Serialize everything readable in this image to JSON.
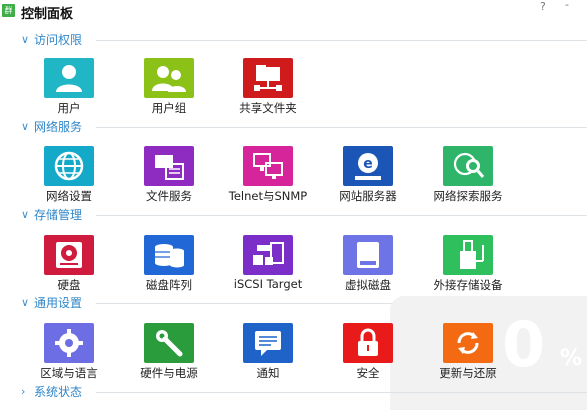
{
  "window": {
    "title": "控制面板",
    "help": "?",
    "dash": "-"
  },
  "sections": [
    {
      "label": "访问权限",
      "items": [
        {
          "label": "用户",
          "icon": "user-icon",
          "color": "#20b6c5"
        },
        {
          "label": "用户组",
          "icon": "user-group-icon",
          "color": "#8cc217"
        },
        {
          "label": "共享文件夹",
          "icon": "shared-folder-icon",
          "color": "#cf1b1b"
        }
      ]
    },
    {
      "label": "网络服务",
      "items": [
        {
          "label": "网络设置",
          "icon": "globe-icon",
          "color": "#14a9c8"
        },
        {
          "label": "文件服务",
          "icon": "file-service-icon",
          "color": "#8e2cc2"
        },
        {
          "label": "Telnet与SNMP",
          "icon": "monitors-icon",
          "color": "#d6249a"
        },
        {
          "label": "网站服务器",
          "icon": "web-server-icon",
          "color": "#1b55b6"
        },
        {
          "label": "网络探索服务",
          "icon": "network-discovery-icon",
          "color": "#2fb56a"
        }
      ]
    },
    {
      "label": "存储管理",
      "items": [
        {
          "label": "硬盘",
          "icon": "hard-disk-icon",
          "color": "#cf1c3e"
        },
        {
          "label": "磁盘阵列",
          "icon": "raid-icon",
          "color": "#2168d6"
        },
        {
          "label": "iSCSI Target",
          "icon": "iscsi-icon",
          "color": "#7b2fc8"
        },
        {
          "label": "虚拟磁盘",
          "icon": "virtual-disk-icon",
          "color": "#6e74e6"
        },
        {
          "label": "外接存储设备",
          "icon": "external-storage-icon",
          "color": "#2fbf5c"
        }
      ]
    },
    {
      "label": "通用设置",
      "items": [
        {
          "label": "区域与语言",
          "icon": "gear-icon",
          "color": "#6d6ee3"
        },
        {
          "label": "硬件与电源",
          "icon": "wrench-icon",
          "color": "#2a9c3b"
        },
        {
          "label": "通知",
          "icon": "notification-icon",
          "color": "#1f63c8"
        },
        {
          "label": "安全",
          "icon": "lock-icon",
          "color": "#e81a1a"
        },
        {
          "label": "更新与还原",
          "icon": "update-icon",
          "color": "#f36a12"
        }
      ]
    },
    {
      "label": "系统状态",
      "items": []
    }
  ],
  "watermark": {
    "value": "0",
    "unit": "%"
  }
}
